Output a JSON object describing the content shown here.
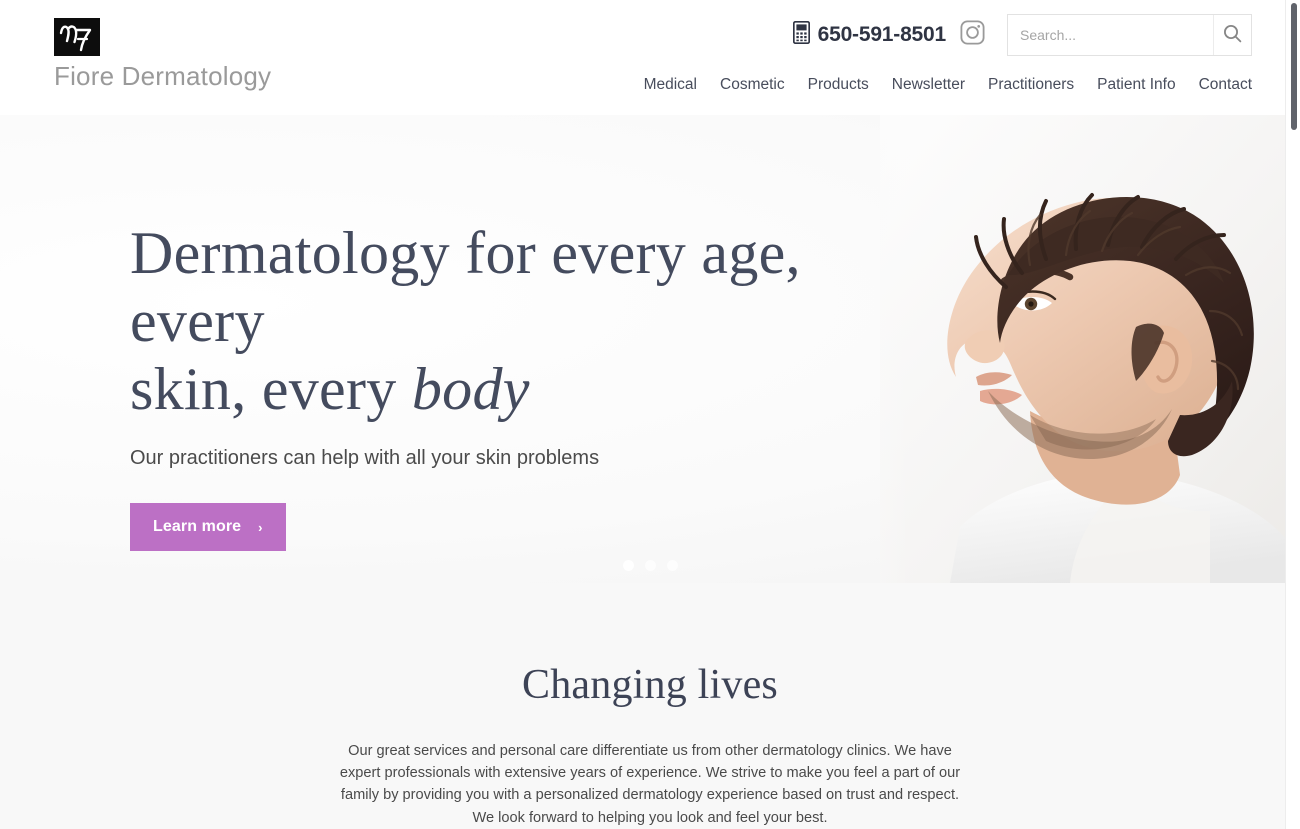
{
  "brand": {
    "logo_mark_name": "fiore-monogram",
    "name": "Fiore Dermatology"
  },
  "header": {
    "phone_icon": "mobile-phone-icon",
    "phone": "650-591-8501",
    "social_icon": "instagram-icon",
    "search": {
      "placeholder": "Search...",
      "value": "",
      "button_icon": "search-icon"
    },
    "nav": [
      {
        "label": "Medical"
      },
      {
        "label": "Cosmetic"
      },
      {
        "label": "Products"
      },
      {
        "label": "Newsletter"
      },
      {
        "label": "Practitioners"
      },
      {
        "label": "Patient Info"
      },
      {
        "label": "Contact"
      }
    ]
  },
  "hero": {
    "title_line1": "Dermatology for every age, every",
    "title_line2_plain": "skin, every ",
    "title_line2_italic": "body",
    "subtitle": "Our practitioners can help with all your skin problems",
    "cta_label": "Learn more",
    "cta_arrow": "›",
    "image_alt": "man-in-profile-photo",
    "carousel": {
      "total": 3,
      "active_index": 0
    }
  },
  "section": {
    "title": "Changing lives",
    "body": "Our great services and personal care differentiate us from other dermatology clinics. We have expert professionals with extensive years of experience. We strive to make you feel a part of our family by providing you with a personalized dermatology experience based on trust and respect.  We look forward to helping you look and feel your best."
  },
  "colors": {
    "accent_purple": "#bc70c5",
    "heading_slate": "#444b5e",
    "nav_text": "#484d5c",
    "logo_gray": "#9a9a9a",
    "section_bg": "#f8f8f8"
  }
}
